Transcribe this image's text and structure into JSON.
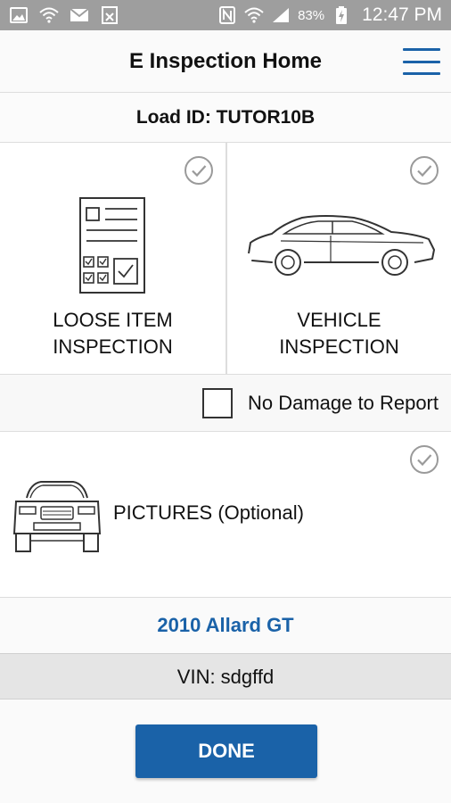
{
  "status_bar": {
    "battery": "83%",
    "time": "12:47 PM",
    "left_icons": [
      "image-icon",
      "wifi-icon",
      "mail-icon",
      "task-icon"
    ],
    "right_icons": [
      "nfc-icon",
      "wifi-icon",
      "signal-icon",
      "battery-charging-icon"
    ]
  },
  "header": {
    "title": "E Inspection Home",
    "menu_icon": "hamburger-menu-icon"
  },
  "load": {
    "text": "Load ID: TUTOR10B"
  },
  "tiles": [
    {
      "line1": "LOOSE ITEM",
      "line2": "INSPECTION",
      "icon": "checklist-icon",
      "status_icon": "check-circle-icon"
    },
    {
      "line1": "VEHICLE",
      "line2": "INSPECTION",
      "icon": "car-side-icon",
      "status_icon": "check-circle-icon"
    }
  ],
  "no_damage": {
    "label": "No Damage to Report",
    "checked": false
  },
  "pictures": {
    "label": "PICTURES (Optional)",
    "icon": "suv-front-icon"
  },
  "vehicle": {
    "name": "2010 Allard GT",
    "vin": "VIN: sdgffd"
  },
  "actions": {
    "done_label": "DONE"
  },
  "colors": {
    "accent": "#1a62a8",
    "status_bar": "#9e9e9e"
  }
}
